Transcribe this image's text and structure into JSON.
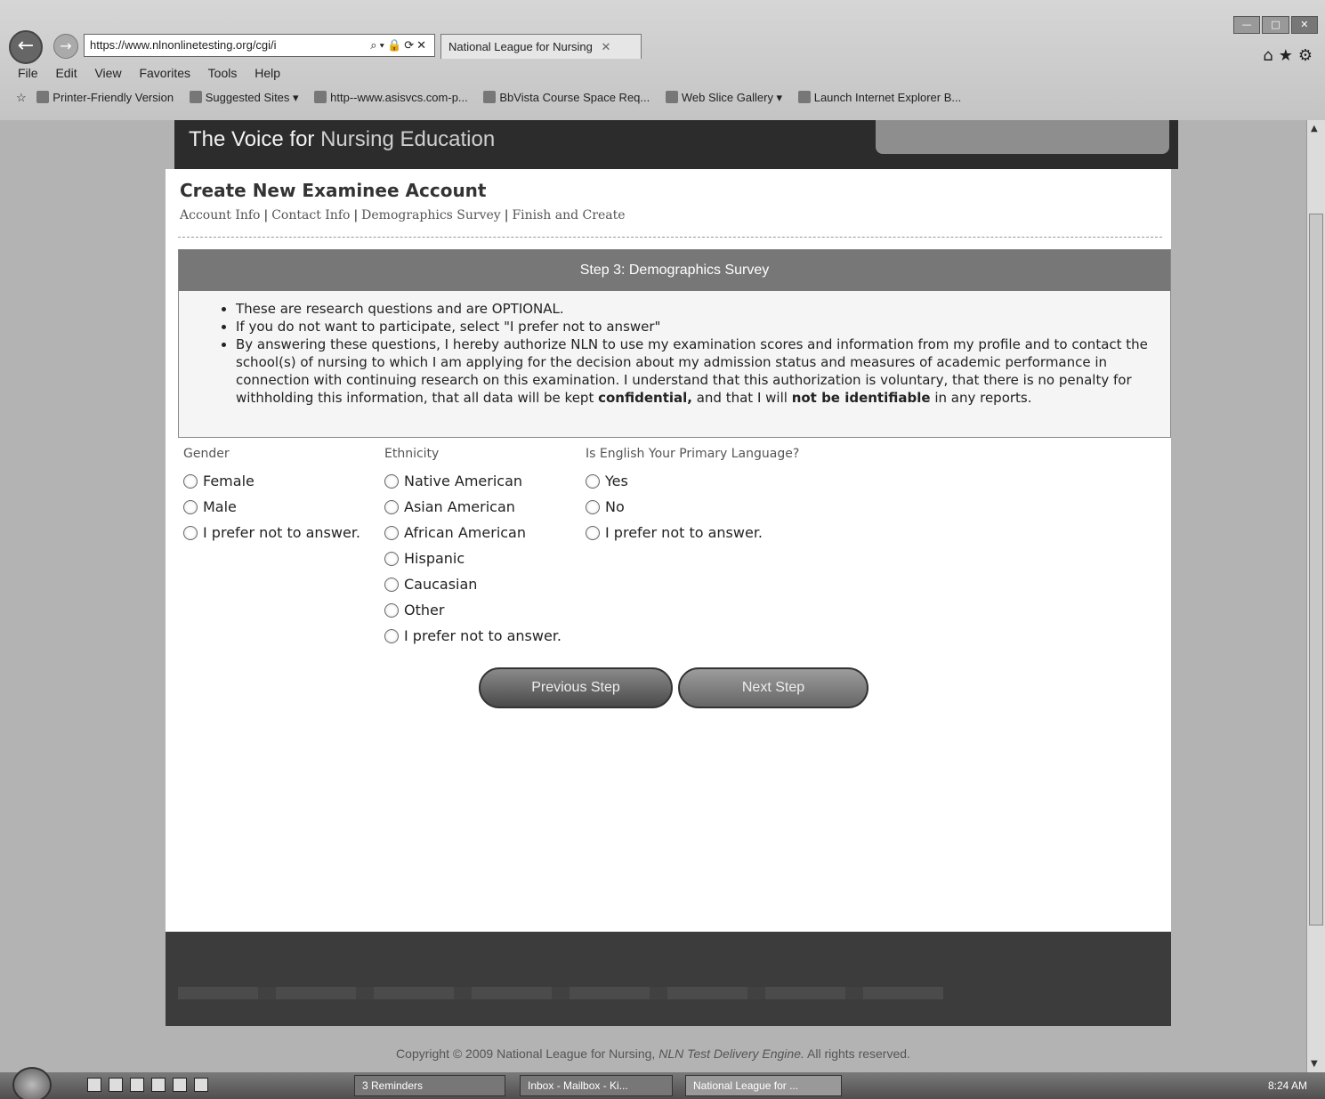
{
  "browser": {
    "address": "https://www.nlnonlinetesting.org/cgi/i",
    "tab_title": "National League for Nursing",
    "menu": [
      "File",
      "Edit",
      "View",
      "Favorites",
      "Tools",
      "Help"
    ],
    "favorites": [
      "Printer-Friendly Version",
      "Suggested Sites ▾",
      "http--www.asisvcs.com-p...",
      "BbVista Course Space Req...",
      "Web Slice Gallery ▾",
      "Launch Internet Explorer B..."
    ]
  },
  "header": {
    "tagline_a": "The Voice for",
    "tagline_b": "Nursing Education"
  },
  "page": {
    "title": "Create New Examinee Account",
    "breadcrumb": [
      "Account Info",
      "Contact Info",
      "Demographics Survey",
      "Finish and Create"
    ],
    "step_title": "Step 3: Demographics Survey",
    "notes": {
      "n1": "These are research questions and are OPTIONAL.",
      "n2": "If you do not want to participate, select \"I prefer not to answer\"",
      "n3_a": "By answering these questions, I hereby authorize NLN to use my examination scores and information from my profile and to contact the school(s) of nursing to which I am applying for the decision about my admission status and measures of academic performance in connection with continuing research on this examination. I understand that this authorization is voluntary, that there is no penalty for withholding this information, that all data will be kept ",
      "n3_b": "confidential,",
      "n3_c": " and that I will ",
      "n3_d": "not be identifiable",
      "n3_e": " in any reports."
    },
    "questions": {
      "gender": {
        "label": "Gender",
        "options": [
          "Female",
          "Male",
          "I prefer not to answer."
        ]
      },
      "ethnicity": {
        "label": "Ethnicity",
        "options": [
          "Native American",
          "Asian American",
          "African American",
          "Hispanic",
          "Caucasian",
          "Other",
          "I prefer not to answer."
        ]
      },
      "english": {
        "label": "Is English Your Primary Language?",
        "options": [
          "Yes",
          "No",
          "I prefer not to answer."
        ]
      }
    },
    "buttons": {
      "previous": "Previous Step",
      "next": "Next Step"
    },
    "copyright_a": "Copyright © 2009 National League for Nursing, ",
    "copyright_b": "NLN Test Delivery Engine.",
    "copyright_c": " All rights reserved."
  },
  "taskbar": {
    "tasks": [
      "3 Reminders",
      "Inbox - Mailbox - Ki...",
      "National League for ..."
    ],
    "clock": "8:24 AM"
  }
}
